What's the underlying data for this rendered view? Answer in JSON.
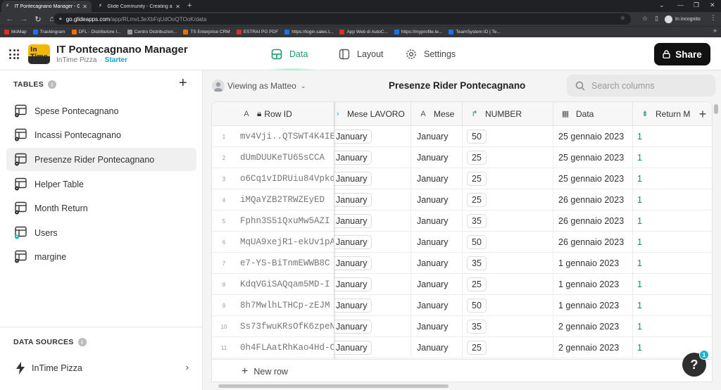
{
  "browser": {
    "tabs": [
      {
        "title": "IT Pontecagnano Manager - Glide",
        "active": true
      },
      {
        "title": "Glide Community - Creating an...",
        "active": false
      }
    ],
    "url_host": "go.glideapps.com",
    "url_path": "/app/RLmvL3eXbFqUdOoQTOoK/data",
    "incognito_label": "In incognito",
    "bookmarks": [
      {
        "label": "MoMap",
        "color": "#d93025"
      },
      {
        "label": "Trackingram",
        "color": "#1a73e8"
      },
      {
        "label": "DFL - Distributore I...",
        "color": "#e8710a"
      },
      {
        "label": "Centro Distribuzion...",
        "color": "#999999"
      },
      {
        "label": "TS Enterprise CRM",
        "color": "#e8710a"
      },
      {
        "label": "ESTRAI PG PDF",
        "color": "#d93025"
      },
      {
        "label": "https://login.sales.t...",
        "color": "#1a73e8"
      },
      {
        "label": "App Web di AutoC...",
        "color": "#d93025"
      },
      {
        "label": "https://myprofile.te...",
        "color": "#1a73e8"
      },
      {
        "label": "TeamSystem ID | Te...",
        "color": "#1a73e8"
      }
    ]
  },
  "app": {
    "logo_text": "In Time",
    "title": "IT Pontecagnano Manager",
    "org": "InTime Pizza",
    "plan": "Starter",
    "tabs": [
      {
        "label": "Data",
        "active": true
      },
      {
        "label": "Layout",
        "active": false
      },
      {
        "label": "Settings",
        "active": false
      }
    ],
    "share_label": "Share",
    "colors": {
      "accent": "#1c9b6b",
      "plan": "#11a7c3",
      "relation": "#138a7e",
      "badge": "#16b5d1"
    }
  },
  "sidebar": {
    "tables_heading": "TABLES",
    "tables": [
      {
        "label": "Spese Pontecagnano",
        "icon": "table-icon"
      },
      {
        "label": "Incassi Pontecagnano",
        "icon": "table-icon"
      },
      {
        "label": "Presenze Rider Pontecagnano",
        "icon": "table-icon",
        "active": true
      },
      {
        "label": "Helper Table",
        "icon": "table-icon"
      },
      {
        "label": "Month Return",
        "icon": "table-icon"
      },
      {
        "label": "Users",
        "icon": "users-table-icon"
      },
      {
        "label": "margine",
        "icon": "table-icon"
      }
    ],
    "data_sources_heading": "DATA SOURCES",
    "data_source": "InTime Pizza"
  },
  "main": {
    "viewing_as": "Viewing as Matteo",
    "table_title": "Presenze Rider Pontecagnano",
    "search_placeholder": "Search columns",
    "columns": [
      {
        "label": "Row ID",
        "icon": "A"
      },
      {
        "label": "Mese LAVORO",
        "icon": "›"
      },
      {
        "label": "Mese",
        "icon": "A"
      },
      {
        "label": "NUMBER",
        "icon": "↱"
      },
      {
        "label": "Data",
        "icon": "▦"
      },
      {
        "label": "Return M",
        "icon": "⇟"
      }
    ],
    "rows": [
      {
        "n": "1",
        "id": "mv4Vji..QTSWT4K4IE1",
        "mese_lavoro": "January",
        "mese": "January",
        "number": "50",
        "data": "25 gennaio 2023",
        "ret": "1"
      },
      {
        "n": "2",
        "id": "dUmDUUKeTU65sCCA",
        "mese_lavoro": "January",
        "mese": "January",
        "number": "25",
        "data": "25 gennaio 2023",
        "ret": "1"
      },
      {
        "n": "3",
        "id": "o6Cq1vIDRUiu84Vpkd",
        "mese_lavoro": "January",
        "mese": "January",
        "number": "25",
        "data": "25 gennaio 2023",
        "ret": "1"
      },
      {
        "n": "4",
        "id": "iMQaYZB2TRWZEyED",
        "mese_lavoro": "January",
        "mese": "January",
        "number": "25",
        "data": "26 gennaio 2023",
        "ret": "1"
      },
      {
        "n": "5",
        "id": "Fphn3S51QxuMw5AZI",
        "mese_lavoro": "January",
        "mese": "January",
        "number": "35",
        "data": "26 gennaio 2023",
        "ret": "1"
      },
      {
        "n": "6",
        "id": "MqUA9xejR1-ekUv1pA",
        "mese_lavoro": "January",
        "mese": "January",
        "number": "50",
        "data": "26 gennaio 2023",
        "ret": "1"
      },
      {
        "n": "7",
        "id": "e7-YS-BiTnmEWWB8C",
        "mese_lavoro": "January",
        "mese": "January",
        "number": "35",
        "data": "1 gennaio 2023",
        "ret": "1"
      },
      {
        "n": "8",
        "id": "KdqVGiSAQqam5MD-I",
        "mese_lavoro": "January",
        "mese": "January",
        "number": "25",
        "data": "1 gennaio 2023",
        "ret": "1"
      },
      {
        "n": "9",
        "id": "8h7MwlhLTHCp-zEJM",
        "mese_lavoro": "January",
        "mese": "January",
        "number": "50",
        "data": "1 gennaio 2023",
        "ret": "1"
      },
      {
        "n": "10",
        "id": "Ss73fwuKRsOfK6zpeN",
        "mese_lavoro": "January",
        "mese": "January",
        "number": "35",
        "data": "2 gennaio 2023",
        "ret": "1"
      },
      {
        "n": "11",
        "id": "0h4FLAatRhKao4Hd-C",
        "mese_lavoro": "January",
        "mese": "January",
        "number": "25",
        "data": "2 gennaio 2023",
        "ret": "1"
      }
    ],
    "new_row_label": "New row"
  },
  "help": {
    "label": "?",
    "badge": "1"
  }
}
